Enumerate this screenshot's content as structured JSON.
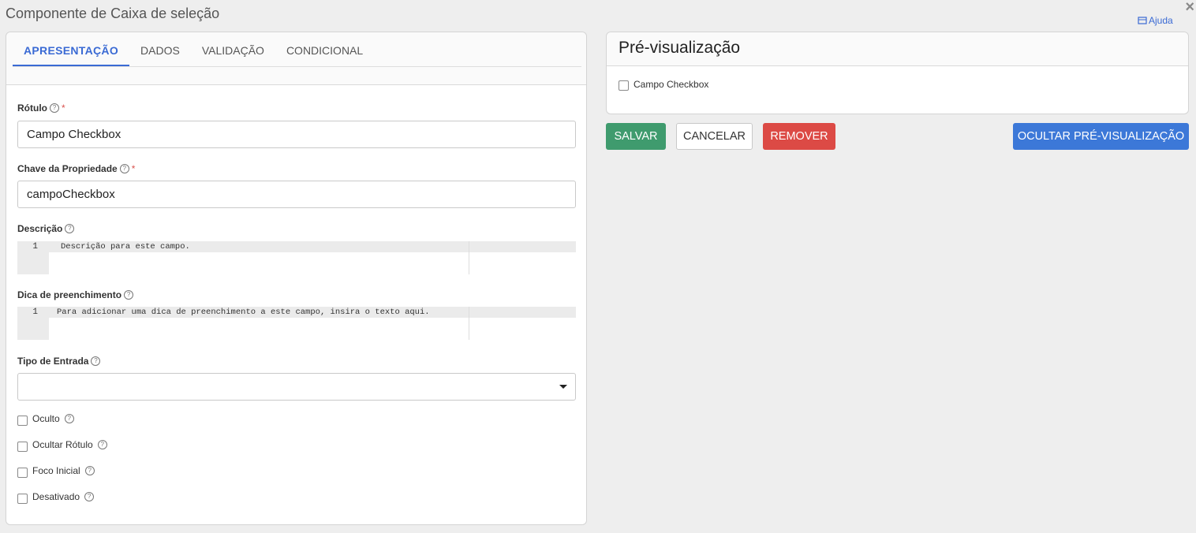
{
  "dialog": {
    "title": "Componente de Caixa de seleção",
    "close_symbol": "×",
    "help_label": "Ajuda"
  },
  "tabs": [
    {
      "label": "APRESENTAÇÃO",
      "active": true
    },
    {
      "label": "DADOS",
      "active": false
    },
    {
      "label": "VALIDAÇÃO",
      "active": false
    },
    {
      "label": "CONDICIONAL",
      "active": false
    }
  ],
  "form": {
    "label_field": {
      "label": "Rótulo",
      "required_mark": "*",
      "value": "Campo Checkbox"
    },
    "key_field": {
      "label": "Chave da Propriedade",
      "required_mark": "*",
      "value": "campoCheckbox"
    },
    "description": {
      "label": "Descrição",
      "line_number": "1",
      "text": "Descrição para este campo."
    },
    "tooltip": {
      "label": "Dica de preenchimento",
      "line_number": "1",
      "text": "Para adicionar uma dica de preenchimento a este campo, insira o texto aqui."
    },
    "input_type": {
      "label": "Tipo de Entrada",
      "value": ""
    },
    "help_icon_glyph": "?",
    "checkboxes": [
      {
        "label": "Oculto",
        "checked": false
      },
      {
        "label": "Ocultar Rótulo",
        "checked": false
      },
      {
        "label": "Foco Inicial",
        "checked": false
      },
      {
        "label": "Desativado",
        "checked": false
      }
    ]
  },
  "preview": {
    "title": "Pré-visualização",
    "checkbox_label": "Campo Checkbox"
  },
  "actions": {
    "save": "SALVAR",
    "cancel": "CANCELAR",
    "remove": "REMOVER",
    "hide_preview": "OCULTAR PRÉ-VISUALIZAÇÃO"
  },
  "colors": {
    "accent": "#3a6ad4",
    "save": "#3f9b6e",
    "remove": "#dc4a45",
    "hide_preview": "#3c78d8",
    "required": "#d9534f"
  },
  "icons": {
    "help_link": "help-book-icon",
    "close": "close-icon",
    "select_caret": "caret-down-icon",
    "field_help": "question-circle-icon"
  }
}
